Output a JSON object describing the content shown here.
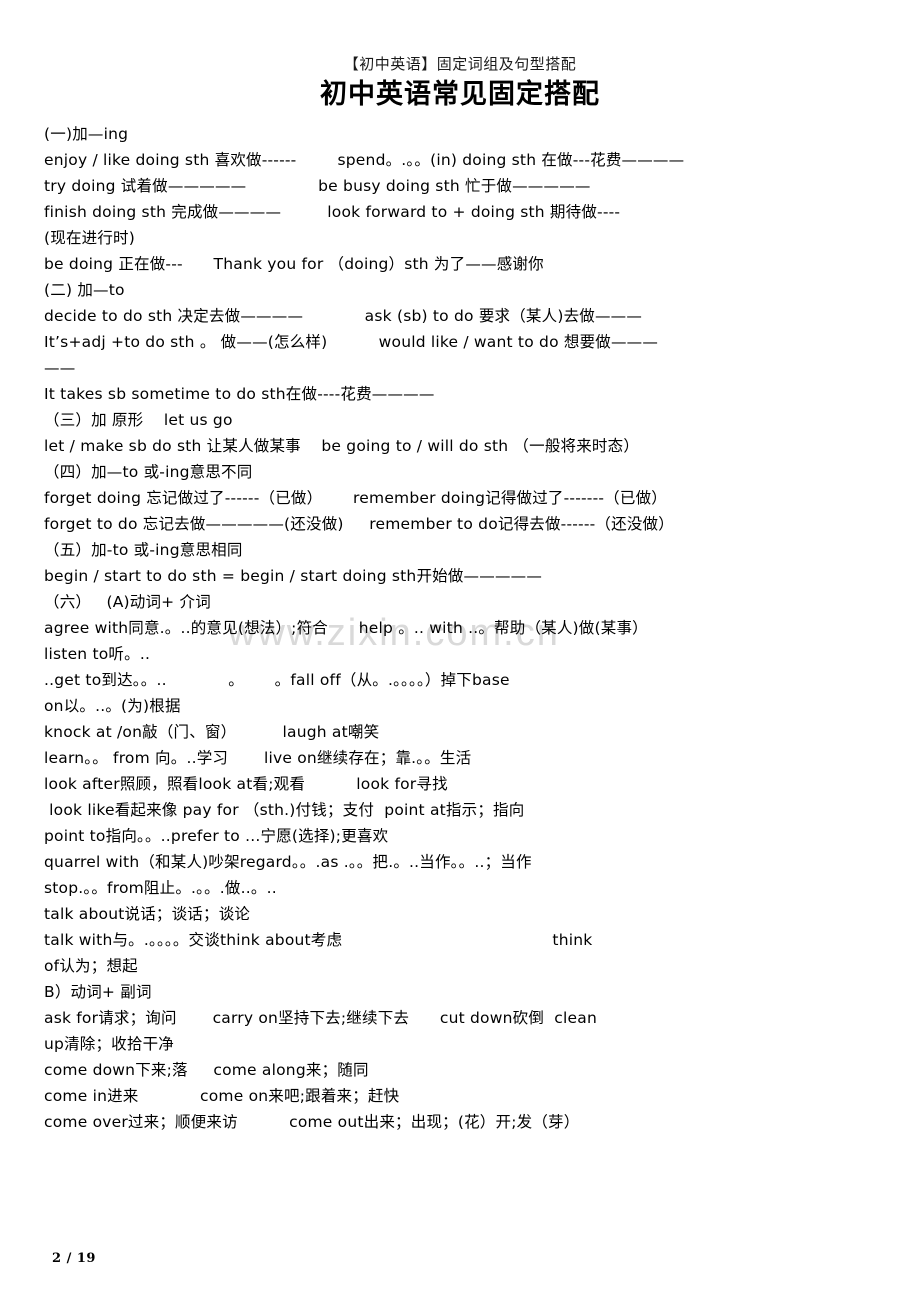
{
  "document": {
    "subtitle": "【初中英语】固定词组及句型搭配",
    "title": "初中英语常见固定搭配",
    "watermark": "www.zixin.com.cn",
    "footer_page": "2 / 19"
  },
  "lines": [
    {
      "id": "l01",
      "text": "(一)加—ing"
    },
    {
      "id": "l02",
      "text": "enjoy / like doing sth 喜欢做------        spend。.。。(in) doing sth 在做---花费————"
    },
    {
      "id": "l03",
      "text": "try doing 试着做—————              be busy doing sth 忙于做—————"
    },
    {
      "id": "l04",
      "text": "finish doing sth 完成做————         look forward to + doing sth 期待做----"
    },
    {
      "id": "l05",
      "text": "(现在进行时)"
    },
    {
      "id": "l06",
      "text": "be doing 正在做---      Thank you for （doing）sth 为了——感谢你"
    },
    {
      "id": "l07",
      "text": "(二) 加—to"
    },
    {
      "id": "l08",
      "text": "decide to do sth 决定去做————            ask (sb) to do 要求（某人)去做———"
    },
    {
      "id": "l09",
      "text": "It’s+adj +to do sth 。 做——(怎么样)          would like / want to do 想要做———"
    },
    {
      "id": "l10",
      "text": "——"
    },
    {
      "id": "l11",
      "text": "It takes sb sometime to do sth在做----花费————"
    },
    {
      "id": "l12",
      "text": "（三）加 原形    let us go"
    },
    {
      "id": "l13",
      "text": "let / make sb do sth 让某人做某事    be going to / will do sth （一般将来时态）"
    },
    {
      "id": "l14",
      "text": "（四）加—to 或-ing意思不同"
    },
    {
      "id": "l15",
      "text": "forget doing 忘记做过了------（已做）      remember doing记得做过了-------（已做）"
    },
    {
      "id": "l16",
      "text": "forget to do 忘记去做—————(还没做)     remember to do记得去做------（还没做）"
    },
    {
      "id": "l17",
      "text": "（五）加-to 或-ing意思相同"
    },
    {
      "id": "l18",
      "text": "begin / start to do sth = begin / start doing sth开始做—————"
    },
    {
      "id": "l19",
      "text": "（六）   (A)动词+ 介词"
    },
    {
      "id": "l20",
      "text": "agree with同意.。..的意见(想法）;符合      help 。.. with ..。帮助（某人)做(某事）"
    },
    {
      "id": "l21",
      "text": "listen to听。.."
    },
    {
      "id": "l22",
      "text": "..get to到达。。..            。      。fall off（从。.。。。。）掉下base"
    },
    {
      "id": "l23",
      "text": "on以。..。(为)根据"
    },
    {
      "id": "l24",
      "text": "knock at /on敲（门、窗）         laugh at嘲笑"
    },
    {
      "id": "l25",
      "text": "learn。。 from 向。..学习       live on继续存在；靠.。。生活"
    },
    {
      "id": "l26",
      "text": "look after照顾，照看look at看;观看          look for寻找"
    },
    {
      "id": "l27",
      "text": " look like看起来像 pay for （sth.)付钱；支付  point at指示；指向"
    },
    {
      "id": "l28",
      "text": "point to指向。。..prefer to ...宁愿(选择);更喜欢"
    },
    {
      "id": "l29",
      "text": "quarrel with（和某人)吵架regard。。.as .。。把.。..当作。。..；当作"
    },
    {
      "id": "l30",
      "text": "stop.。。from阻止。.。。.做..。.."
    },
    {
      "id": "l31",
      "text": "talk about说话；谈话；谈论"
    },
    {
      "id": "l32",
      "text": "talk with与。.。。。。交谈think about考虑                                         think"
    },
    {
      "id": "l33",
      "text": "of认为；想起"
    },
    {
      "id": "l34",
      "text": "B）动词+ 副词"
    },
    {
      "id": "l35",
      "text": "ask for请求；询问       carry on坚持下去;继续下去      cut down砍倒  clean"
    },
    {
      "id": "l36",
      "text": "up清除；收拾干净"
    },
    {
      "id": "l37",
      "text": "come down下来;落     come along来；随同"
    },
    {
      "id": "l38",
      "text": "come in进来            come on来吧;跟着来；赶快"
    },
    {
      "id": "l39",
      "text": "come over过来；顺便来访          come out出来；出现；(花）开;发（芽）"
    }
  ]
}
